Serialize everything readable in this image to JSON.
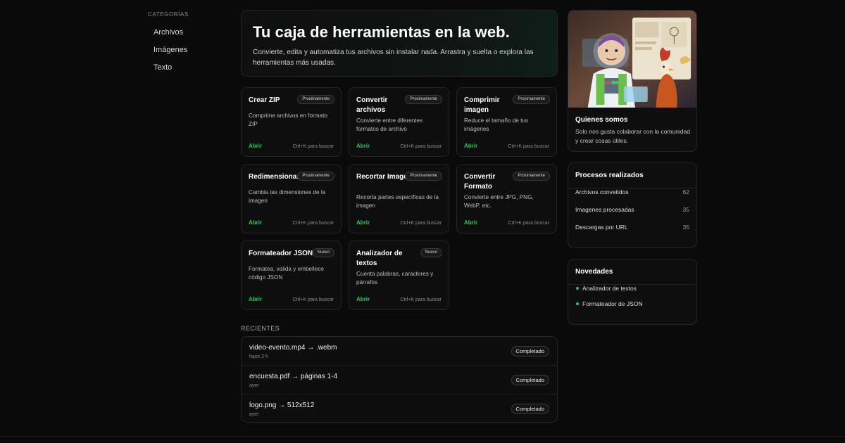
{
  "sidebar": {
    "title": "CATEGORÍAS",
    "items": [
      {
        "label": "Archivos"
      },
      {
        "label": "Imágenes"
      },
      {
        "label": "Texto"
      }
    ]
  },
  "hero": {
    "title": "Tu caja de herramientas en la web.",
    "subtitle": "Convierte, edita y automatiza tus archivos sin instalar nada. Arrastra y suelta o explora las herramientas más usadas."
  },
  "tools": [
    {
      "title": "Crear ZIP",
      "badge": "Proximamente",
      "desc": "Comprime archivos en formato ZIP",
      "open": "Abrir",
      "hint": "Ctrl+K para buscar"
    },
    {
      "title": "Convertir archivos",
      "badge": "Proximamente",
      "desc": "Convierte entre diferentes formatos de archivo",
      "open": "Abrir",
      "hint": "Ctrl+K para buscar"
    },
    {
      "title": "Comprimir imagen",
      "badge": "Proximamente",
      "desc": "Reduce el tamaño de tus imágenes",
      "open": "Abrir",
      "hint": "Ctrl+K para buscar"
    },
    {
      "title": "Redimensionar",
      "badge": "Proximamente",
      "desc": "Cambia las dimensiones de la imagen",
      "open": "Abrir",
      "hint": "Ctrl+K para buscar"
    },
    {
      "title": "Recortar Imagen",
      "badge": "Proximamente",
      "desc": "Recorta partes específicas de la imagen",
      "open": "Abrir",
      "hint": "Ctrl+K para buscar"
    },
    {
      "title": "Convertir Formato",
      "badge": "Proximamente",
      "desc": "Convierte entre JPG, PNG, WebP, etc.",
      "open": "Abrir",
      "hint": "Ctrl+K para buscar"
    },
    {
      "title": "Formateador JSON",
      "badge": "Nuevo",
      "desc": "Formatea, valida y embellece código JSON",
      "open": "Abrir",
      "hint": "Ctrl+K para buscar"
    },
    {
      "title": "Analizador de textos",
      "badge": "Nuevo",
      "desc": "Cuenta palabras, caracteres y párrafos",
      "open": "Abrir",
      "hint": "Ctrl+K para buscar"
    }
  ],
  "recent": {
    "title": "RECIENTES",
    "items": [
      {
        "name": "video-evento.mp4 → .webm",
        "time": "hace 2 h",
        "status": "Completado"
      },
      {
        "name": "encuesta.pdf → páginas 1-4",
        "time": "ayer",
        "status": "Completado"
      },
      {
        "name": "logo.png → 512x512",
        "time": "ayer",
        "status": "Completado"
      }
    ]
  },
  "about": {
    "title": "Quienes somos",
    "desc": "Solo nos gusta colaborar con la comunidad y crear cosas útiles."
  },
  "stats": {
    "title": "Procesos realizados",
    "items": [
      {
        "label": "Archivos convetidos",
        "value": "62"
      },
      {
        "label": "Imagenes procesadas",
        "value": "35"
      },
      {
        "label": "Descargas por URL",
        "value": "35"
      }
    ]
  },
  "news": {
    "title": "Novedades",
    "items": [
      {
        "label": "Analizador de textos"
      },
      {
        "label": "Formateador de JSON"
      }
    ]
  },
  "colors": {
    "accent": "#22c55e",
    "background": "#0a0a0a",
    "card": "#0e0e0e",
    "border": "#242424"
  }
}
